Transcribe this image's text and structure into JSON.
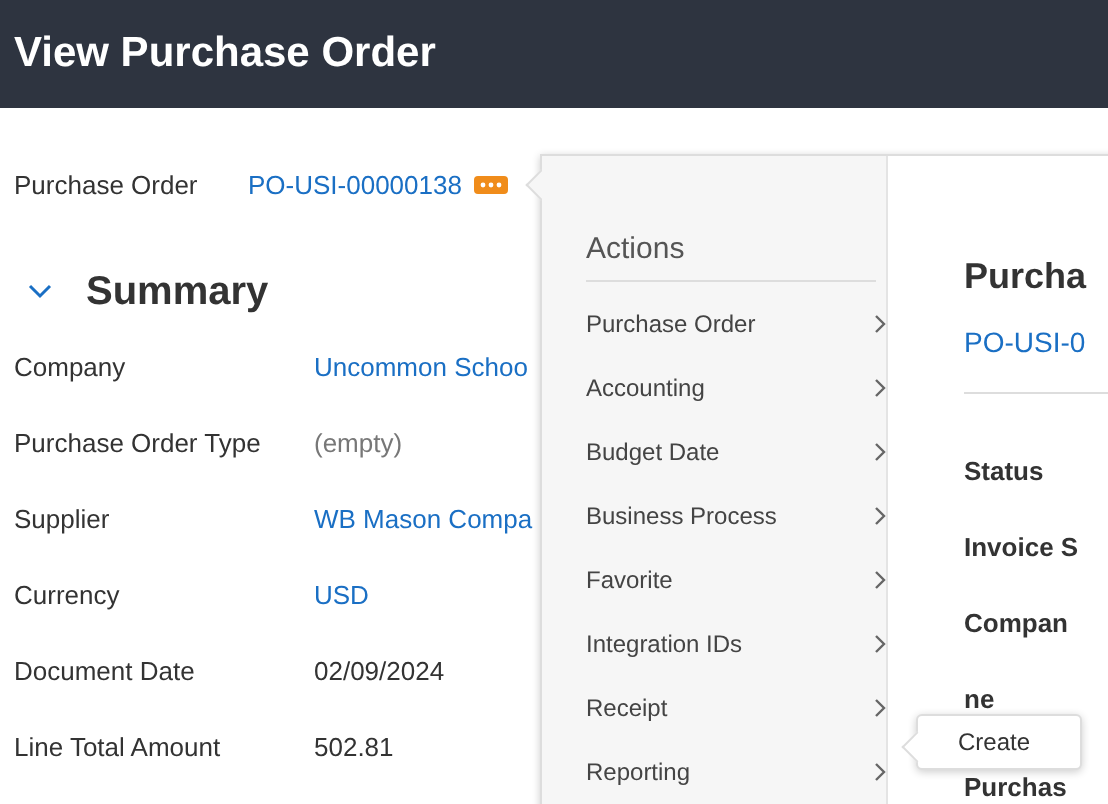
{
  "header": {
    "title": "View Purchase Order"
  },
  "purchase_order": {
    "label": "Purchase Order",
    "value": "PO-USI-00000138"
  },
  "summary": {
    "title": "Summary",
    "expanded": true
  },
  "fields": [
    {
      "label": "Company",
      "value": "Uncommon Schoo",
      "kind": "link"
    },
    {
      "label": "Purchase Order Type",
      "value": "(empty)",
      "kind": "empty"
    },
    {
      "label": "Supplier",
      "value": "WB Mason Compa",
      "kind": "link"
    },
    {
      "label": "Currency",
      "value": "USD",
      "kind": "link"
    },
    {
      "label": "Document Date",
      "value": "02/09/2024",
      "kind": "text"
    },
    {
      "label": "Line Total Amount",
      "value": "502.81",
      "kind": "text"
    }
  ],
  "actions_popup": {
    "title": "Actions",
    "items": [
      {
        "label": "Purchase Order"
      },
      {
        "label": "Accounting"
      },
      {
        "label": "Budget Date"
      },
      {
        "label": "Business Process"
      },
      {
        "label": "Favorite"
      },
      {
        "label": "Integration IDs"
      },
      {
        "label": "Receipt"
      },
      {
        "label": "Reporting"
      }
    ],
    "detail": {
      "title": "Purcha",
      "number": "PO-USI-0",
      "fields": [
        "Status",
        "Invoice S",
        "Compan",
        "ne",
        "Purchas"
      ]
    }
  },
  "submenu": {
    "items": [
      "Create"
    ]
  }
}
